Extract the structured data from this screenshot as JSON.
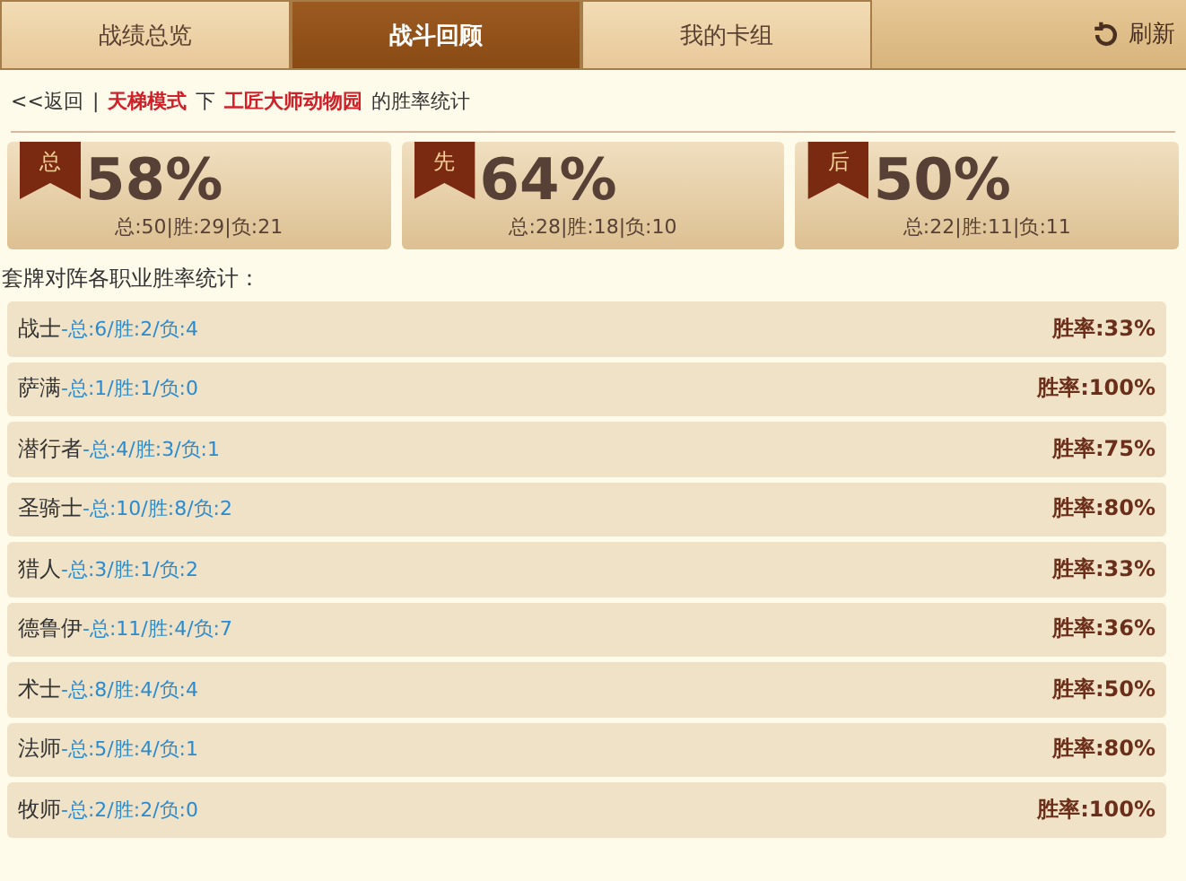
{
  "tabs": [
    {
      "label": "战绩总览",
      "selected": false
    },
    {
      "label": "战斗回顾",
      "selected": true
    },
    {
      "label": "我的卡组",
      "selected": false
    }
  ],
  "refresh": "刷新",
  "breadcrumb": {
    "back": "<<返回",
    "separator": "|",
    "mode": "天梯模式",
    "joiner": "下",
    "deck": "工匠大师动物园",
    "suffix": "的胜率统计"
  },
  "stats": [
    {
      "tag": "总",
      "rate": "58%",
      "detail": "总:50|胜:29|负:21"
    },
    {
      "tag": "先",
      "rate": "64%",
      "detail": "总:28|胜:18|负:10"
    },
    {
      "tag": "后",
      "rate": "50%",
      "detail": "总:22|胜:11|负:11"
    }
  ],
  "section_title": "套牌对阵各职业胜率统计：",
  "classes": [
    {
      "name": "战士",
      "record": "-总:6/胜:2/负:4",
      "rate": "胜率:33%"
    },
    {
      "name": "萨满",
      "record": "-总:1/胜:1/负:0",
      "rate": "胜率:100%"
    },
    {
      "name": "潜行者",
      "record": "-总:4/胜:3/负:1",
      "rate": "胜率:75%"
    },
    {
      "name": "圣骑士",
      "record": "-总:10/胜:8/负:2",
      "rate": "胜率:80%"
    },
    {
      "name": "猎人",
      "record": "-总:3/胜:1/负:2",
      "rate": "胜率:33%"
    },
    {
      "name": "德鲁伊",
      "record": "-总:11/胜:4/负:7",
      "rate": "胜率:36%"
    },
    {
      "name": "术士",
      "record": "-总:8/胜:4/负:4",
      "rate": "胜率:50%"
    },
    {
      "name": "法师",
      "record": "-总:5/胜:4/负:1",
      "rate": "胜率:80%"
    },
    {
      "name": "牧师",
      "record": "-总:2/胜:2/负:0",
      "rate": "胜率:100%"
    }
  ]
}
